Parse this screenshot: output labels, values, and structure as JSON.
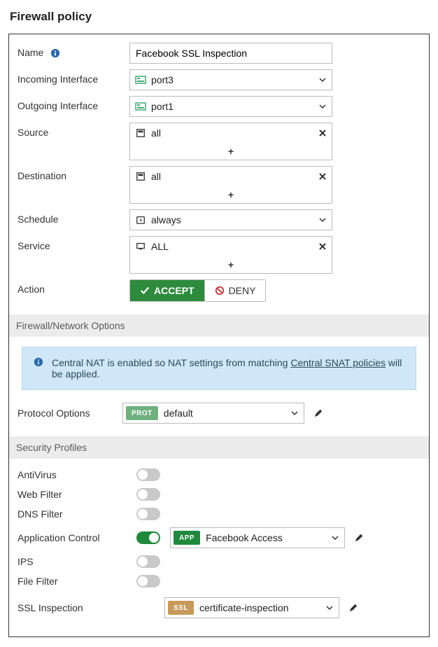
{
  "page_title": "Firewall policy",
  "labels": {
    "name": "Name",
    "incoming": "Incoming Interface",
    "outgoing": "Outgoing Interface",
    "source": "Source",
    "destination": "Destination",
    "schedule": "Schedule",
    "service": "Service",
    "action": "Action",
    "protocol_options": "Protocol Options"
  },
  "fields": {
    "name": "Facebook SSL Inspection",
    "incoming": "port3",
    "outgoing": "port1",
    "source": "all",
    "destination": "all",
    "schedule": "always",
    "service": "ALL"
  },
  "action": {
    "accept": "ACCEPT",
    "deny": "DENY"
  },
  "sections": {
    "fw_net": "Firewall/Network Options",
    "sec_profiles": "Security Profiles"
  },
  "banner": {
    "text_a": "Central NAT is enabled so NAT settings from matching ",
    "link": "Central SNAT policies",
    "text_b": " will be applied."
  },
  "protocol_options": {
    "badge": "PROT",
    "value": "default"
  },
  "profiles": {
    "antivirus": "AntiVirus",
    "webfilter": "Web Filter",
    "dnsfilter": "DNS Filter",
    "appcontrol": "Application Control",
    "ips": "IPS",
    "filefilter": "File Filter",
    "sslinspect": "SSL Inspection"
  },
  "appcontrol": {
    "badge": "APP",
    "value": "Facebook Access"
  },
  "sslinspect": {
    "badge": "SSL",
    "value": "certificate-inspection"
  },
  "glyphs": {
    "plus": "+"
  }
}
